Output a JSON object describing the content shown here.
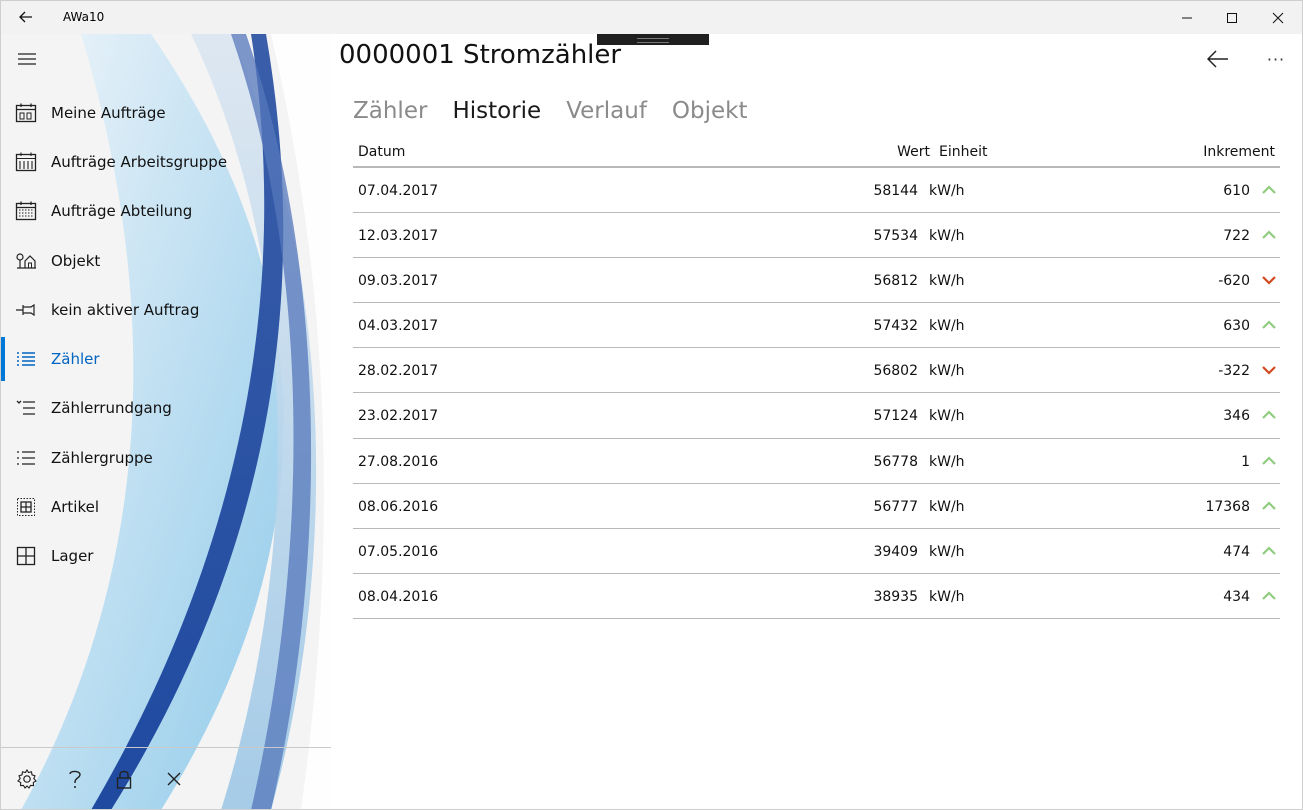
{
  "window": {
    "title": "AWa10"
  },
  "colors": {
    "accent": "#0078d7",
    "up": "#8fcc7f",
    "down": "#d2471c"
  },
  "sidebar": {
    "items": [
      {
        "label": "Meine Aufträge",
        "icon": "calendar-icon"
      },
      {
        "label": "Aufträge Arbeitsgruppe",
        "icon": "calendar-icon"
      },
      {
        "label": "Aufträge Abteilung",
        "icon": "calendar-icon"
      },
      {
        "label": "Objekt",
        "icon": "building-icon"
      },
      {
        "label": "kein aktiver Auftrag",
        "icon": "pin-icon"
      },
      {
        "label": "Zähler",
        "icon": "list-icon",
        "active": true
      },
      {
        "label": "Zählerrundgang",
        "icon": "list-icon"
      },
      {
        "label": "Zählergruppe",
        "icon": "list-icon"
      },
      {
        "label": "Artikel",
        "icon": "grid-icon"
      },
      {
        "label": "Lager",
        "icon": "grid-icon"
      }
    ],
    "footer": [
      "gear-icon",
      "help-icon",
      "lock-icon",
      "close-icon"
    ]
  },
  "main": {
    "title": "0000001 Stromzähler",
    "more": "···",
    "tabs": [
      {
        "label": "Zähler",
        "active": false
      },
      {
        "label": "Historie",
        "active": true
      },
      {
        "label": "Verlauf",
        "active": false
      },
      {
        "label": "Objekt",
        "active": false
      }
    ],
    "table": {
      "headers": {
        "date": "Datum",
        "value": "Wert",
        "unit": "Einheit",
        "increment": "Inkrement"
      },
      "rows": [
        {
          "date": "07.04.2017",
          "value": "58144",
          "unit": "kW/h",
          "increment": "610",
          "trend": "up"
        },
        {
          "date": "12.03.2017",
          "value": "57534",
          "unit": "kW/h",
          "increment": "722",
          "trend": "up"
        },
        {
          "date": "09.03.2017",
          "value": "56812",
          "unit": "kW/h",
          "increment": "-620",
          "trend": "down"
        },
        {
          "date": "04.03.2017",
          "value": "57432",
          "unit": "kW/h",
          "increment": "630",
          "trend": "up"
        },
        {
          "date": "28.02.2017",
          "value": "56802",
          "unit": "kW/h",
          "increment": "-322",
          "trend": "down"
        },
        {
          "date": "23.02.2017",
          "value": "57124",
          "unit": "kW/h",
          "increment": "346",
          "trend": "up"
        },
        {
          "date": "27.08.2016",
          "value": "56778",
          "unit": "kW/h",
          "increment": "1",
          "trend": "up"
        },
        {
          "date": "08.06.2016",
          "value": "56777",
          "unit": "kW/h",
          "increment": "17368",
          "trend": "up"
        },
        {
          "date": "07.05.2016",
          "value": "39409",
          "unit": "kW/h",
          "increment": "474",
          "trend": "up"
        },
        {
          "date": "08.04.2016",
          "value": "38935",
          "unit": "kW/h",
          "increment": "434",
          "trend": "up"
        }
      ]
    }
  }
}
